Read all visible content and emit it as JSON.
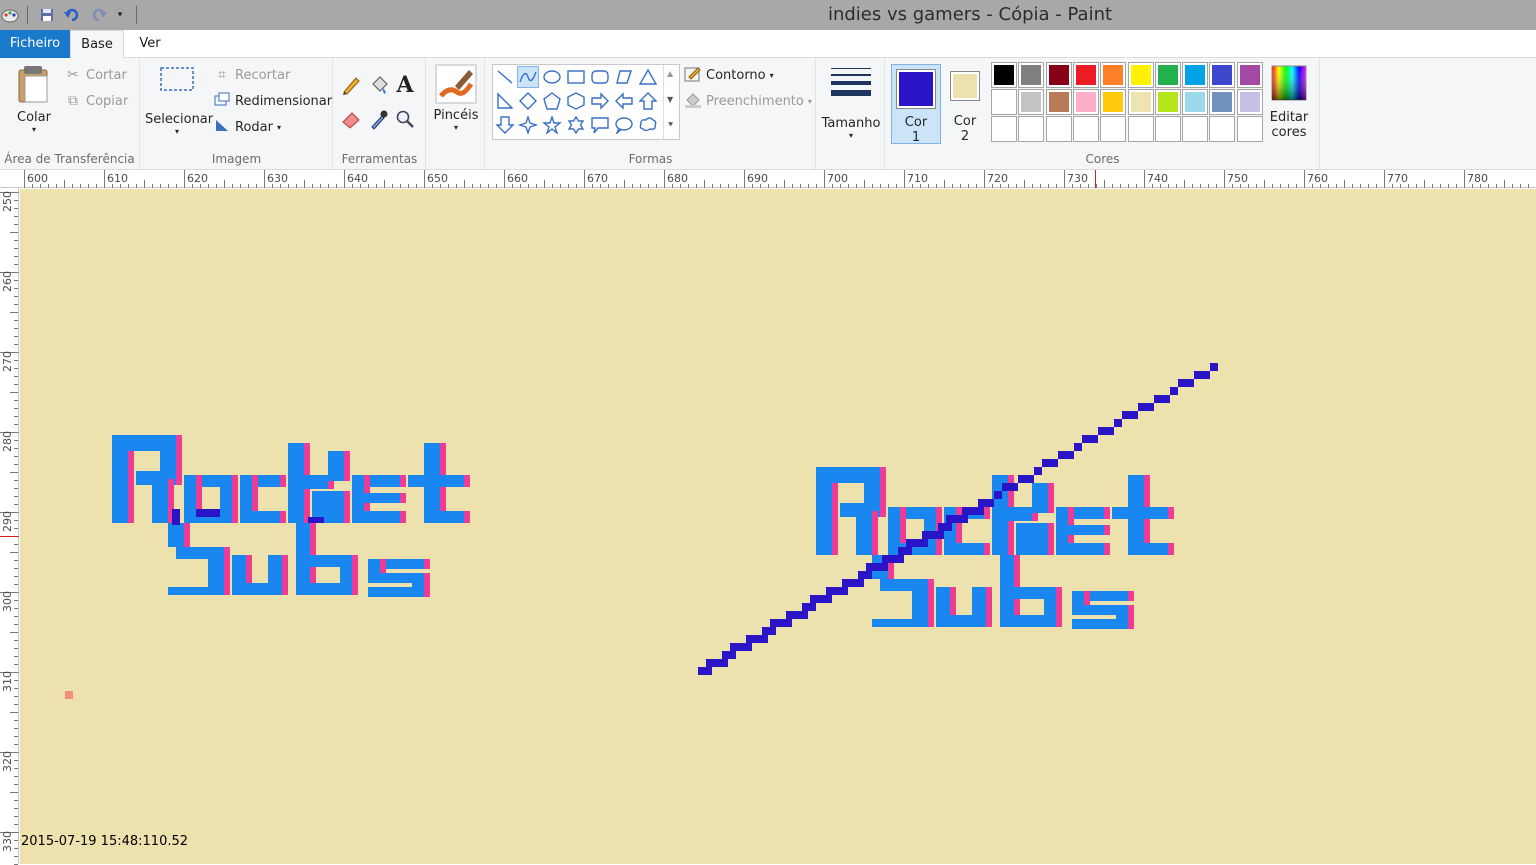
{
  "window": {
    "title": "indies vs gamers - Cópia - Paint"
  },
  "tabs": {
    "file": "Ficheiro",
    "home": "Base",
    "view": "Ver"
  },
  "clipboard": {
    "paste": "Colar",
    "cut": "Cortar",
    "copy": "Copiar",
    "label": "Área de Transferência"
  },
  "image": {
    "select": "Selecionar",
    "crop": "Recortar",
    "resize": "Redimensionar",
    "rotate": "Rodar",
    "label": "Imagem"
  },
  "tools": {
    "label": "Ferramentas"
  },
  "brushes": {
    "label": "Pincéis"
  },
  "shapes": {
    "outline": "Contorno",
    "fill": "Preenchimento",
    "label": "Formas"
  },
  "size": {
    "label": "Tamanho"
  },
  "colors": {
    "color1_label_a": "Cor",
    "color1_label_b": "1",
    "color2_label_a": "Cor",
    "color2_label_b": "2",
    "edit_label_a": "Editar",
    "edit_label_b": "cores",
    "label": "Cores",
    "color1": "#2a14c8",
    "color2": "#ede2ae",
    "palette_row1": [
      "#000000",
      "#7f7f7f",
      "#880015",
      "#ed1c24",
      "#ff7f27",
      "#fff200",
      "#22b14c",
      "#00a2e8",
      "#3f48cc",
      "#a349a4"
    ],
    "palette_row2": [
      "#ffffff",
      "#c3c3c3",
      "#b97a57",
      "#ffaec9",
      "#ffc90e",
      "#efe4b0",
      "#b5e61d",
      "#99d9ea",
      "#7092be",
      "#c8bfe7"
    ]
  },
  "ruler": {
    "top": [
      "600",
      "610",
      "620",
      "630",
      "640",
      "650",
      "660",
      "670",
      "680",
      "690",
      "700",
      "710",
      "720",
      "730",
      "740",
      "750",
      "760",
      "770",
      "780"
    ],
    "left": [
      "250",
      "260",
      "270",
      "280",
      "290",
      "300",
      "310",
      "320",
      "330"
    ]
  },
  "canvas": {
    "bg": "#ede2ae",
    "timestamp": "2015-07-19 15:48:110.52",
    "logo_primary": "#1a87f0",
    "logo_shadow": "#ee3c96",
    "line_color": "#2a14c8"
  }
}
